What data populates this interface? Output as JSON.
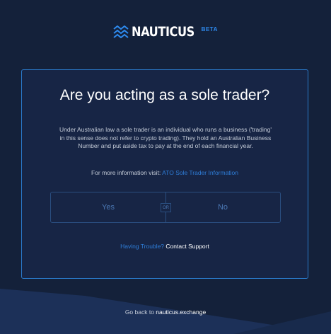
{
  "brand": {
    "name": "NAUTICUS",
    "badge": "BETA",
    "logo_icon": "waves-icon",
    "accent_color": "#2e8bf0"
  },
  "card": {
    "title": "Are you acting as a sole trader?",
    "description": "Under Australian law a sole trader is an individual who runs a business ('trading' in this sense does not refer to crypto trading). They hold an Australian Business Number and put aside tax to pay at the end of each financial year.",
    "more_info_label": "For more information visit:",
    "more_info_link": "ATO Sole Trader Information",
    "yes_label": "Yes",
    "or_label": "OR",
    "no_label": "No",
    "support_prefix": "Having Trouble?",
    "support_link": "Contact Support",
    "border_color": "#2a79c9"
  },
  "footer": {
    "prefix": "Go back to",
    "link": "nauticus.exchange"
  },
  "colors": {
    "background": "#14213a",
    "card_background": "#172545",
    "link": "#2e7dd8"
  }
}
